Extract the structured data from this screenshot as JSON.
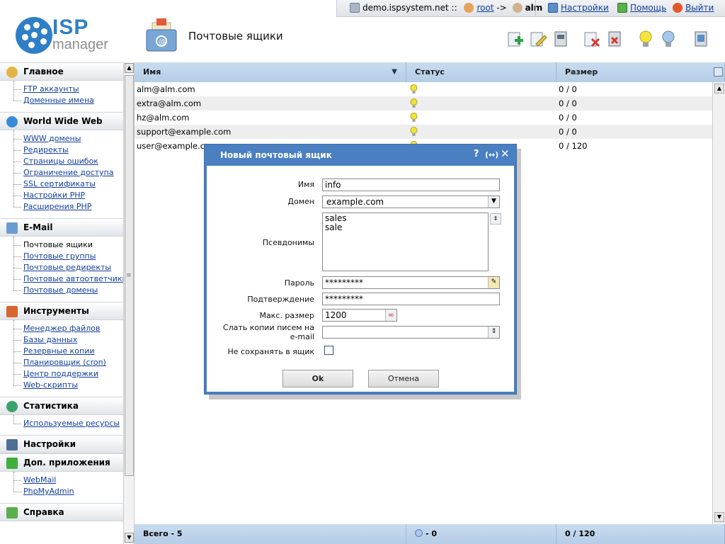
{
  "topbar": {
    "server": "demo.ispsystem.net ::",
    "user_root": "root",
    "arrow": "->",
    "user_current": "alm",
    "settings": "Настройки",
    "help": "Помощь",
    "logout": "Выйти"
  },
  "logo": {
    "word1": "ISP",
    "word2": "manager"
  },
  "page": {
    "title": "Почтовые ящики"
  },
  "sidebar": {
    "groups": [
      {
        "title": "Главное",
        "icon": "home-icon",
        "items": [
          "FTP аккаунты",
          "Доменные имена"
        ]
      },
      {
        "title": "World Wide Web",
        "icon": "globe-icon",
        "items": [
          "WWW домены",
          "Редиректы",
          "Страницы ошибок",
          "Ограничение доступа",
          "SSL сертификаты",
          "Настройки PHP",
          "Расширения PHP"
        ]
      },
      {
        "title": "E-Mail",
        "icon": "mail-icon",
        "items": [
          "Почтовые ящики",
          "Почтовые группы",
          "Почтовые редиректы",
          "Почтовые автоответчики",
          "Почтовые домены"
        ]
      },
      {
        "title": "Инструменты",
        "icon": "tools-icon",
        "items": [
          "Менеджер файлов",
          "Базы данных",
          "Резервные копии",
          "Планировщик (cron)",
          "Центр поддержки",
          "Web-скрипты"
        ]
      },
      {
        "title": "Статистика",
        "icon": "chart-icon",
        "items": [
          "Используемые ресурсы"
        ]
      },
      {
        "title": "Настройки",
        "icon": "settings-icon",
        "items": []
      },
      {
        "title": "Доп. приложения",
        "icon": "plus-icon",
        "items": [
          "WebMail",
          "PhpMyAdmin"
        ]
      },
      {
        "title": "Справка",
        "icon": "help-icon",
        "items": []
      }
    ]
  },
  "table": {
    "columns": [
      "Имя",
      "Статус",
      "Размер"
    ],
    "rows": [
      {
        "name": "alm@alm.com",
        "size": "0 / 0"
      },
      {
        "name": "extra@alm.com",
        "size": "0 / 0"
      },
      {
        "name": "hz@alm.com",
        "size": "0 / 0"
      },
      {
        "name": "support@example.com",
        "size": "0 / 0"
      },
      {
        "name": "user@example.com",
        "size": "0 / 120"
      }
    ],
    "footer": {
      "total": "Всего - 5",
      "status": "- 0",
      "size": "0 / 120"
    }
  },
  "dialog": {
    "title": "Новый почтовый ящик",
    "help_btn": "?",
    "expand_btn": "(↔)",
    "close_btn": "✕",
    "fields": {
      "name_label": "Имя",
      "name_value": "info",
      "domain_label": "Домен",
      "domain_value": "example.com",
      "aliases_label": "Псевдонимы",
      "aliases_value": [
        "sales",
        "sale"
      ],
      "password_label": "Пароль",
      "password_value": "*********",
      "confirm_label": "Подтверждение",
      "confirm_value": "*********",
      "maxsize_label": "Макс. размер",
      "maxsize_value": "1200",
      "copies_label_1": "Слать копии писем на",
      "copies_label_2": "e-mail",
      "copies_value": "",
      "nosave_label": "Не сохранять в ящик"
    },
    "ok": "Ok",
    "cancel": "Отмена"
  },
  "colors": {
    "accent": "#4a7fc1",
    "header": "#b5cde6",
    "link": "#123e9c",
    "bulb": "#f1e23a"
  }
}
